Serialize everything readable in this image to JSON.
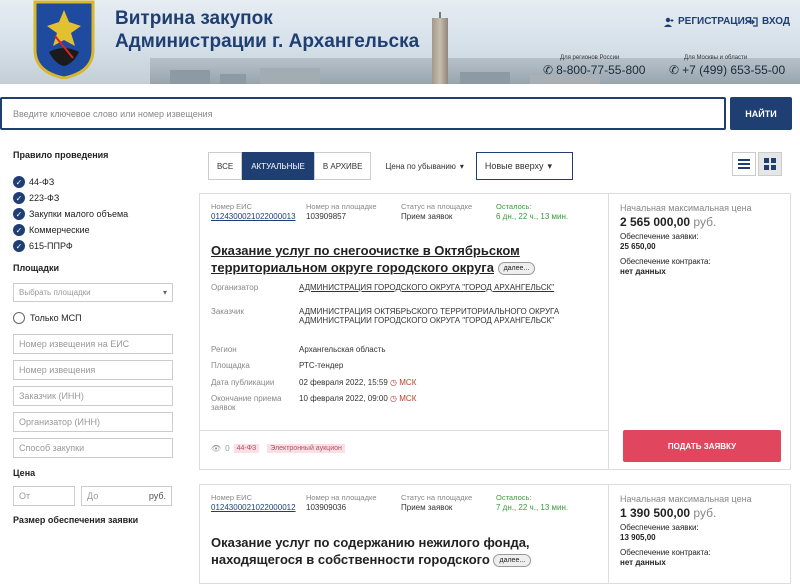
{
  "header": {
    "title_line1": "Витрина закупок",
    "title_line2": "Администрации г. Архангельска",
    "register": "РЕГИСТРАЦИЯ",
    "login": "ВХОД",
    "phone_region_caption": "Для регионов России",
    "phone_region": "8-800-77-55-800",
    "phone_moscow_caption": "Для Москвы и области",
    "phone_moscow": "+7 (499) 653-55-00"
  },
  "search": {
    "placeholder": "Введите ключевое слово или номер извещения",
    "button": "НАЙТИ"
  },
  "sidebar": {
    "rules_title": "Правило проведения",
    "rules": [
      "44-ФЗ",
      "223-ФЗ",
      "Закупки малого объема",
      "Коммерческие",
      "615-ППРФ"
    ],
    "platforms_title": "Площадки",
    "platforms_placeholder": "Выбрать площадки",
    "only_msp": "Только МСП",
    "fields": [
      "Номер извещения на ЕИС",
      "Номер извещения",
      "Заказчик (ИНН)",
      "Организатор (ИНН)",
      "Способ закупки"
    ],
    "price_title": "Цена",
    "price_from": "От",
    "price_to": "До",
    "currency": "руб.",
    "security_title": "Размер обеспечения заявки"
  },
  "filters": {
    "all": "ВСЕ",
    "actual": "АКТУАЛЬНЫЕ",
    "archive": "В АРХИВЕ",
    "sort_price": "Цена по убыванию",
    "sort_new": "Новые вверху"
  },
  "labels": {
    "eis_number": "Номер ЕИС",
    "platform_number": "Номер на площадке",
    "status": "Статус на площадке",
    "remaining": "Осталось:",
    "organizer": "Организатор",
    "customer": "Заказчик",
    "region": "Регион",
    "platform": "Площадка",
    "pub_date": "Дата публикации",
    "end_date": "Окончание приема заявок",
    "nmc": "Начальная максимальная цена",
    "bid_security": "Обеспечение заявки:",
    "contract_security": "Обеспечение контракта:",
    "more": "далее...",
    "apply": "ПОДАТЬ ЗАЯВКУ",
    "tz": "МСК"
  },
  "cards": [
    {
      "eis": "0124300021022000013",
      "platform_no": "103909857",
      "status": "Прием заявок",
      "remaining": "6 дн., 22 ч., 13 мин.",
      "title_l1": "Оказание услуг по снегоочистке в Октябрьском",
      "title_l2": "территориальном округе городского округа",
      "organizer": "АДМИНИСТРАЦИЯ ГОРОДСКОГО ОКРУГА \"ГОРОД АРХАНГЕЛЬСК\"",
      "customer": "АДМИНИСТРАЦИЯ ОКТЯБРЬСКОГО ТЕРРИТОРИАЛЬНОГО ОКРУГА АДМИНИСТРАЦИИ ГОРОДСКОГО ОКРУГА \"ГОРОД АРХАНГЕЛЬСК\"",
      "region": "Архангельская область",
      "platform": "РТС-тендер",
      "pub_date": "02 февраля 2022, 15:59",
      "end_date": "10 февраля 2022, 09:00",
      "views": "0",
      "law": "44-ФЗ",
      "method": "Электронный аукцион",
      "price": "2 565 000,00",
      "price_cur": "руб.",
      "bid_security": "25 650,00",
      "contract_security": "нет данных"
    },
    {
      "eis": "0124300021022000012",
      "platform_no": "103909036",
      "status": "Прием заявок",
      "remaining": "7 дн., 22 ч., 13 мин.",
      "title_l1": "Оказание услуг по содержанию нежилого фонда,",
      "title_l2": "находящегося в собственности городского",
      "price": "1 390 500,00",
      "price_cur": "руб.",
      "bid_security": "13 905,00",
      "contract_security": "нет данных"
    }
  ]
}
